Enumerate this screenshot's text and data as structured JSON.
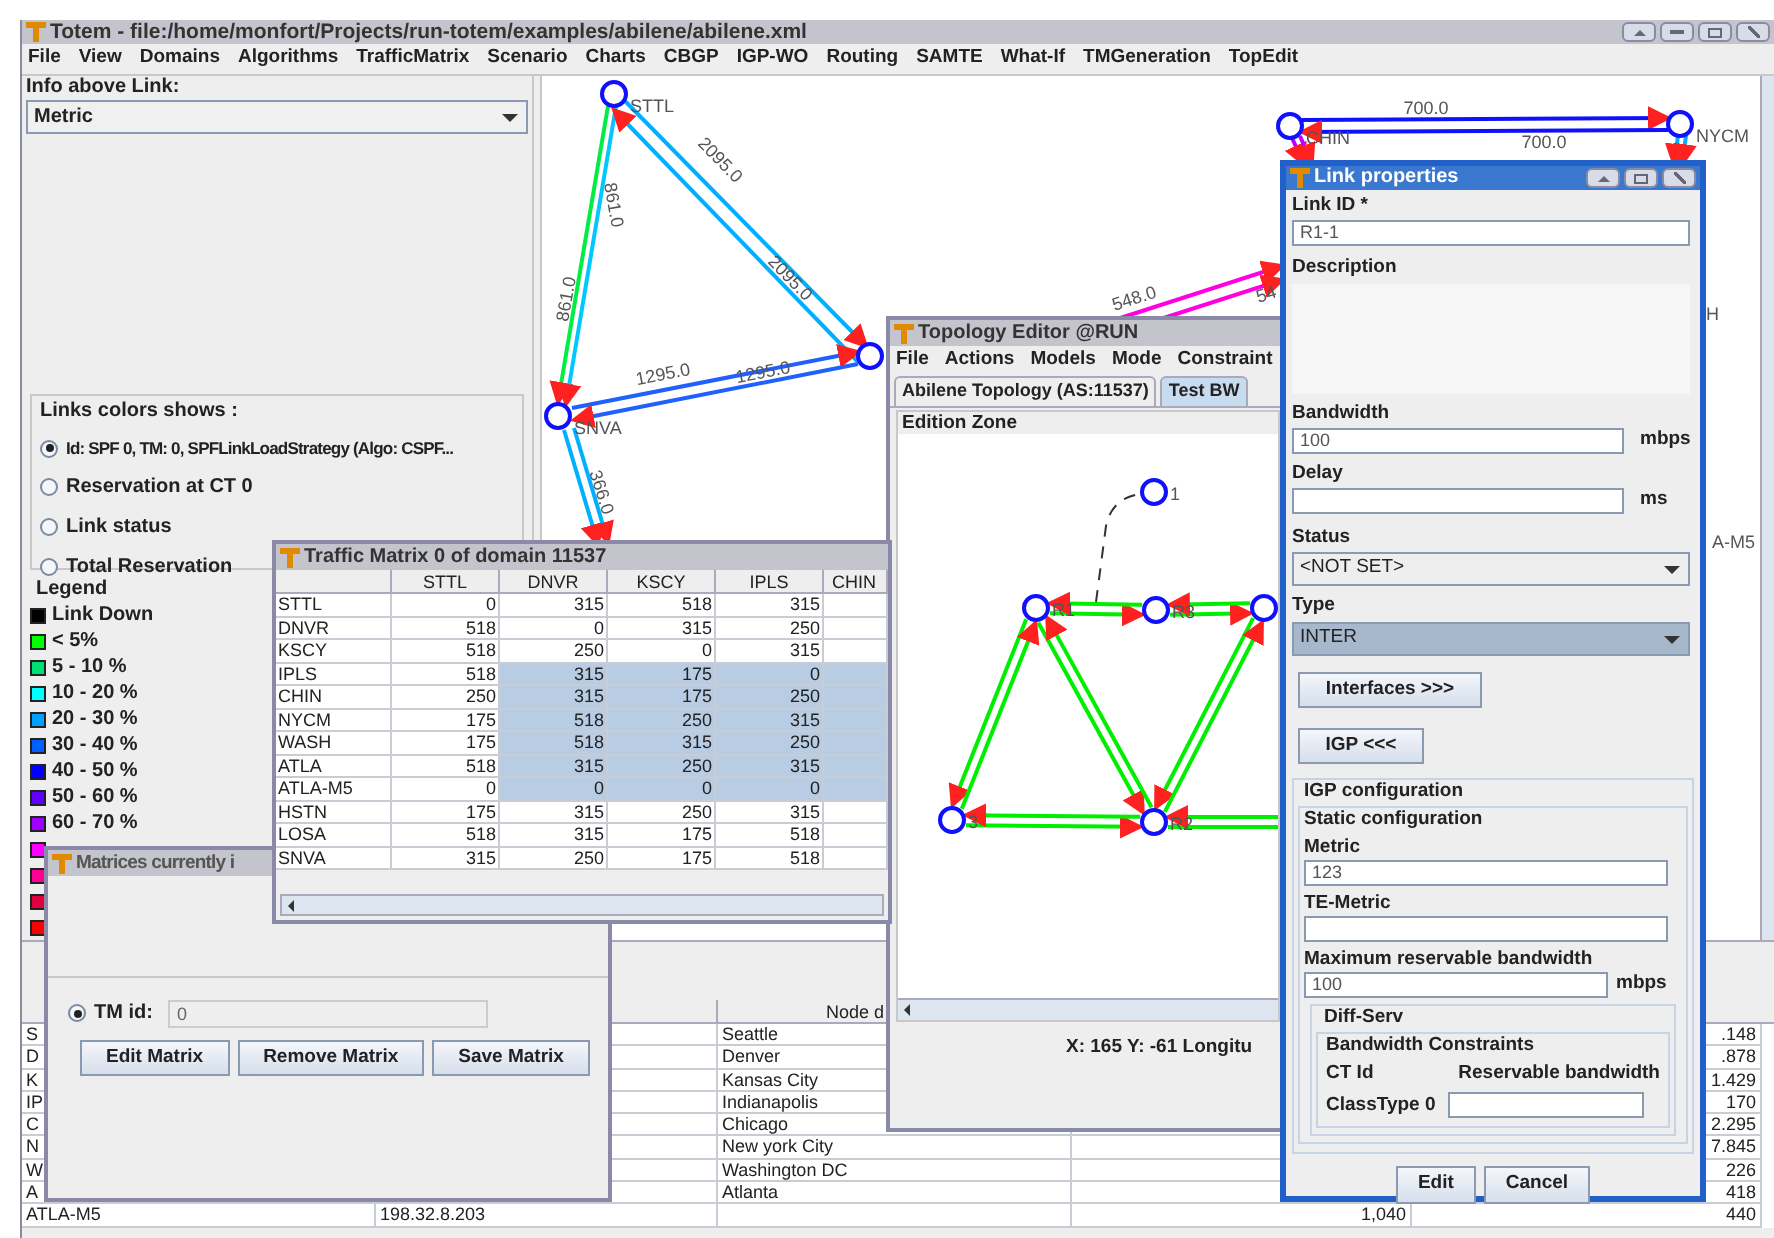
{
  "main_window": {
    "title": "Totem - file:/home/monfort/Projects/run-totem/examples/abilene/abilene.xml"
  },
  "menu": [
    "File",
    "View",
    "Domains",
    "Algorithms",
    "TrafficMatrix",
    "Scenario",
    "Charts",
    "CBGP",
    "IGP-WO",
    "Routing",
    "SAMTE",
    "What-If",
    "TMGeneration",
    "TopEdit"
  ],
  "left_panel": {
    "info_label": "Info above Link:",
    "info_select": "Metric",
    "colors_group": {
      "title": "Links colors shows :",
      "options": [
        {
          "label": "Id: SPF 0, TM: 0, SPFLinkLoadStrategy (Algo: CSPF...",
          "selected": true
        },
        {
          "label": "Reservation at CT 0",
          "selected": false
        },
        {
          "label": "Link status",
          "selected": false
        },
        {
          "label": "Total Reservation",
          "selected": false
        }
      ]
    },
    "legend": {
      "title": "Legend",
      "items": [
        {
          "label": "Link Down",
          "color": "#000000"
        },
        {
          "label": "< 5%",
          "color": "#00ff00"
        },
        {
          "label": "5 - 10 %",
          "color": "#00e070"
        },
        {
          "label": "10 - 20 %",
          "color": "#00ffff"
        },
        {
          "label": "20 - 30 %",
          "color": "#00a0ff"
        },
        {
          "label": "30 - 40 %",
          "color": "#0060ff"
        },
        {
          "label": "40 - 50 %",
          "color": "#0000ff"
        },
        {
          "label": "50 - 60 %",
          "color": "#6000ff"
        },
        {
          "label": "60 - 70 %",
          "color": "#a000ff"
        },
        {
          "color": "#ff00ff"
        },
        {
          "color": "#ff0090"
        },
        {
          "color": "#e00040"
        },
        {
          "color": "#ff0000"
        }
      ]
    }
  },
  "graph": {
    "nodes": [
      {
        "kind": "router",
        "label": "STTL"
      },
      {
        "kind": "router",
        "label": "SNVA"
      },
      {
        "kind": "router"
      },
      {
        "kind": "router",
        "label": "CHIN"
      },
      {
        "kind": "router",
        "label": "NYCM"
      }
    ],
    "links": [
      {
        "color": "#00ee44",
        "label": "861.0"
      },
      {
        "color": "#00c8ff",
        "label": "861.0"
      },
      {
        "color": "#00b0ff",
        "label": "2095.0"
      },
      {
        "color": "#00b0ff",
        "label": "2095.0"
      },
      {
        "color": "#2060ff",
        "label": "1295.0"
      },
      {
        "color": "#2060ff",
        "label": "1295.0"
      },
      {
        "color": "#00b0ff",
        "label": "366.0"
      },
      {
        "color": "#00b0ff"
      },
      {
        "color": "#1010ff",
        "label": "700.0"
      },
      {
        "color": "#1010ff",
        "label": "700.0"
      },
      {
        "color": "#ff00e0",
        "label": "548.0"
      },
      {
        "color": "#ff00e0",
        "label": "54"
      },
      {
        "color": "#c000ff"
      },
      {
        "color": "#c000ff"
      },
      {
        "color": "#00b0ff"
      },
      {
        "color": "#00b0ff"
      }
    ],
    "fragments": [
      "H",
      "A-M5"
    ]
  },
  "node_table": {
    "header": "Node d",
    "rows": [
      {
        "column_1": "S",
        "column_3": "Seattle",
        "column_5": ".148"
      },
      {
        "column_1": "D",
        "column_3": "Denver",
        "column_5": ".878"
      },
      {
        "column_1": "K",
        "column_3": "Kansas City",
        "column_5": "1.429"
      },
      {
        "column_1": "IP",
        "column_3": "Indianapolis",
        "column_5": "170"
      },
      {
        "column_1": "C",
        "column_3": "Chicago",
        "column_5": "2.295"
      },
      {
        "column_1": "N",
        "column_3": "New york City",
        "column_5": "7.845"
      },
      {
        "column_1": "W",
        "column_3": "Washington DC",
        "column_5": "226"
      },
      {
        "column_1": "A",
        "column_3": "Atlanta",
        "column_5": "418"
      },
      {
        "column_1": "ATLA-M5",
        "column_2": "198.32.8.203",
        "column_4": "1,040",
        "column_5": "440"
      }
    ]
  },
  "traffic_matrix": {
    "title": "Traffic Matrix 0 of domain 11537",
    "columns": [
      {
        "label": "STTL",
        "selected": false
      },
      {
        "label": "DNVR",
        "selected": true
      },
      {
        "label": "KSCY",
        "selected": true
      },
      {
        "label": "IPLS",
        "selected": true
      },
      {
        "label": "CHIN",
        "selected": true
      }
    ],
    "rows": [
      {
        "label": "STTL",
        "values": [
          "0",
          "315",
          "518",
          "315"
        ],
        "selected": false
      },
      {
        "label": "DNVR",
        "values": [
          "518",
          "0",
          "315",
          "250"
        ],
        "selected": false
      },
      {
        "label": "KSCY",
        "values": [
          "518",
          "250",
          "0",
          "315"
        ],
        "selected": false
      },
      {
        "label": "IPLS",
        "values": [
          "518",
          "315",
          "175",
          "0"
        ],
        "selected": true
      },
      {
        "label": "CHIN",
        "values": [
          "250",
          "315",
          "175",
          "250"
        ],
        "selected": true
      },
      {
        "label": "NYCM",
        "values": [
          "175",
          "518",
          "250",
          "315"
        ],
        "selected": true
      },
      {
        "label": "WASH",
        "values": [
          "175",
          "518",
          "315",
          "250"
        ],
        "selected": true
      },
      {
        "label": "ATLA",
        "values": [
          "518",
          "315",
          "250",
          "315"
        ],
        "selected": true
      },
      {
        "label": "ATLA-M5",
        "values": [
          "0",
          "0",
          "0",
          "0"
        ],
        "selected": true
      },
      {
        "label": "HSTN",
        "values": [
          "175",
          "315",
          "250",
          "315"
        ],
        "selected": false
      },
      {
        "label": "LOSA",
        "values": [
          "518",
          "315",
          "175",
          "518"
        ],
        "selected": false
      },
      {
        "label": "SNVA",
        "values": [
          "315",
          "250",
          "175",
          "518"
        ],
        "selected": false
      }
    ]
  },
  "matrices_window": {
    "title": "Matrices currently i",
    "tm_radio": {
      "label": "TM id:",
      "selected": true
    },
    "tm_value": "0",
    "buttons": [
      "Edit Matrix",
      "Remove Matrix",
      "Save Matrix"
    ]
  },
  "topology_editor": {
    "title": "Topology Editor @RUN",
    "menu": [
      "File",
      "Actions",
      "Models",
      "Mode",
      "Constraint"
    ],
    "tabs": [
      {
        "label": "Abilene Topology (AS:11537)",
        "selected": false
      },
      {
        "label": "Test BW",
        "selected": true
      }
    ],
    "zone_title": "Edition Zone",
    "graph": {
      "nodes": [
        {
          "kind": "router",
          "label": "1"
        },
        {
          "kind": "router",
          "label": "R1"
        },
        {
          "kind": "router",
          "label": "R3"
        },
        {
          "kind": "router"
        },
        {
          "kind": "router",
          "label": "3"
        },
        {
          "kind": "router",
          "label": "R2"
        }
      ],
      "links": [
        {
          "color": "#00ee00"
        },
        {
          "color": "#00ee00"
        },
        {
          "color": "#00ee00"
        },
        {
          "color": "#00ee00"
        },
        {
          "color": "#00ee00"
        },
        {
          "color": "#00ee00"
        },
        {
          "color": "#00ee00"
        }
      ]
    },
    "status": "X: 165  Y: -61  Longitu"
  },
  "link_properties": {
    "title": "Link properties",
    "link_id_label": "Link ID *",
    "link_id": "R1-1",
    "description_label": "Description",
    "bandwidth_label": "Bandwidth",
    "bandwidth": "100",
    "bandwidth_unit": "mbps",
    "delay_label": "Delay",
    "delay_unit": "ms",
    "status_label": "Status",
    "status": "<NOT SET>",
    "type_label": "Type",
    "type": "INTER",
    "type_highlighted": true,
    "interfaces_button": "Interfaces >>>",
    "igp_button": "IGP <<<",
    "igp_group": "IGP configuration",
    "static_group": "Static configuration",
    "metric_label": "Metric",
    "metric": "123",
    "te_metric_label": "TE-Metric",
    "max_bw_label": "Maximum reservable bandwidth",
    "max_bw": "100",
    "max_bw_unit": "mbps",
    "diffserv_group": "Diff-Serv",
    "bc_group": "Bandwidth Constraints",
    "ct_header": "CT Id",
    "reservable_header": "Reservable bandwidth",
    "class_type": "ClassType 0",
    "buttons": [
      "Edit",
      "Cancel"
    ]
  }
}
